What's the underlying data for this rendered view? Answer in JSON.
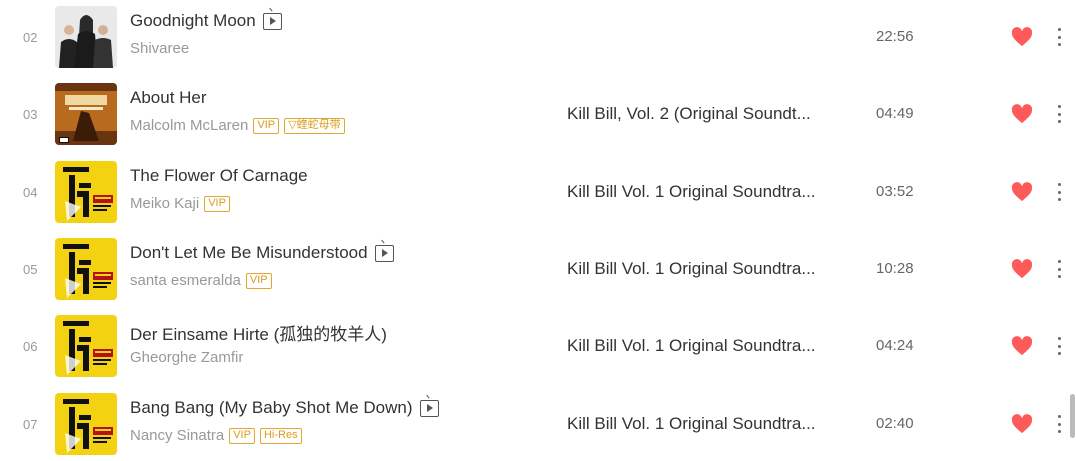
{
  "colors": {
    "heart": "#ff5a5a",
    "vip": "#d89c20",
    "muted": "#999999"
  },
  "rows": [
    {
      "index": "02",
      "title": "Goodnight Moon",
      "has_mv": true,
      "artist": "Shivaree",
      "badges": [],
      "album": "",
      "duration": "22:56",
      "cover": "band-photo"
    },
    {
      "index": "03",
      "title": "About Her",
      "has_mv": false,
      "artist": "Malcolm McLaren",
      "badges": [
        "VIP",
        "蝰蛇母带"
      ],
      "album": "Kill Bill, Vol. 2 (Original Soundt...",
      "duration": "04:49",
      "cover": "kill-bill-vol2"
    },
    {
      "index": "04",
      "title": "The Flower Of Carnage",
      "has_mv": false,
      "artist": "Meiko Kaji",
      "badges": [
        "VIP"
      ],
      "album": "Kill Bill Vol. 1 Original Soundtra...",
      "duration": "03:52",
      "cover": "kill-bill-vol1"
    },
    {
      "index": "05",
      "title": "Don't Let Me Be Misunderstood",
      "has_mv": true,
      "artist": "santa esmeralda",
      "badges": [
        "VIP"
      ],
      "album": "Kill Bill Vol. 1 Original Soundtra...",
      "duration": "10:28",
      "cover": "kill-bill-vol1"
    },
    {
      "index": "06",
      "title": "Der Einsame Hirte (孤独的牧羊人)",
      "has_mv": false,
      "artist": "Gheorghe Zamfir",
      "badges": [],
      "album": "Kill Bill Vol. 1 Original Soundtra...",
      "duration": "04:24",
      "cover": "kill-bill-vol1"
    },
    {
      "index": "07",
      "title": "Bang Bang (My Baby Shot Me Down)",
      "has_mv": true,
      "artist": "Nancy Sinatra",
      "badges": [
        "VIP",
        "Hi-Res"
      ],
      "album": "Kill Bill Vol. 1 Original Soundtra...",
      "duration": "02:40",
      "cover": "kill-bill-vol1"
    }
  ]
}
